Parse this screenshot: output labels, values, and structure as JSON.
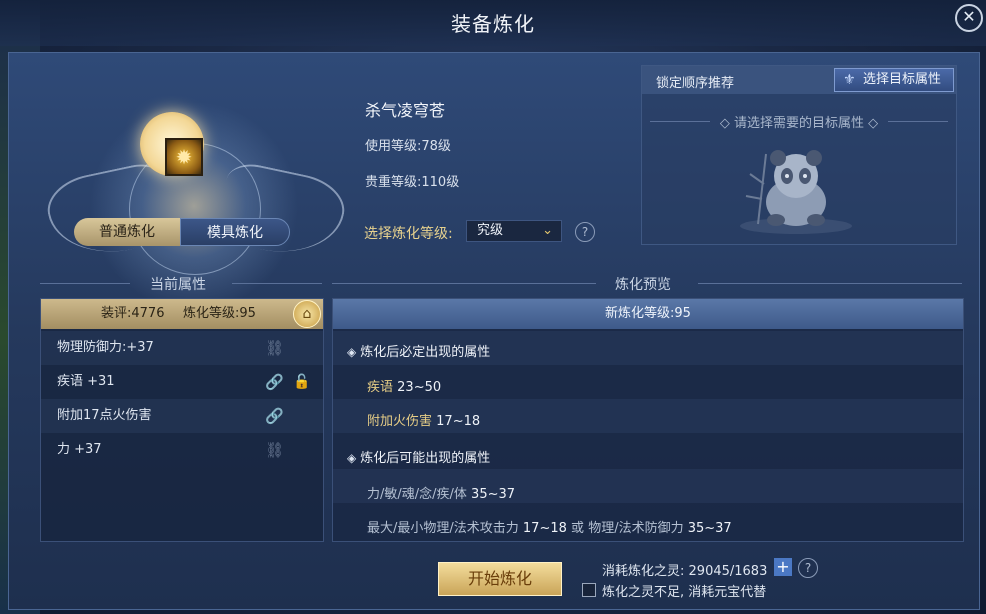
{
  "window": {
    "title": "装备炼化",
    "close_icon": "close-icon"
  },
  "tabs": {
    "normal": "普通炼化",
    "mold": "模具炼化"
  },
  "item": {
    "name": "杀气凌穹苍",
    "use_level_label": "使用等级:",
    "use_level_value": "78级",
    "value_level_label": "贵重等级:",
    "value_level_value": "110级",
    "icon": "emblem-icon"
  },
  "refine": {
    "label": "选择炼化等级:",
    "selected": "究级",
    "help": "?"
  },
  "lock_panel": {
    "label": "锁定顺序推荐",
    "target_button": "选择目标属性",
    "hint": "请选择需要的目标属性"
  },
  "current": {
    "section_title": "当前属性",
    "score": "装评:4776",
    "refine_level": "炼化等级:95",
    "rows": [
      {
        "text": "物理防御力:+37",
        "link": "broken"
      },
      {
        "text": "疾语 +31",
        "link": "linked",
        "lock": "unlocked"
      },
      {
        "text": "附加17点火伤害",
        "link": "linked"
      },
      {
        "text": "力 +37",
        "link": "broken"
      }
    ]
  },
  "preview": {
    "section_title": "炼化预览",
    "new_level": "新炼化等级:95",
    "must_title": "炼化后必定出现的属性",
    "must_rows": [
      {
        "name": "疾语",
        "range": "23~50"
      },
      {
        "name": "附加火伤害",
        "range": "17~18"
      }
    ],
    "may_title": "炼化后可能出现的属性",
    "may_rows": [
      {
        "name": "力/敏/魂/念/疾/体",
        "range": "35~37"
      },
      {
        "name": "最大/最小物理/法术攻击力",
        "range": "17~18",
        "or": "或",
        "name2": "物理/法术防御力",
        "range2": "35~37"
      }
    ]
  },
  "bottom": {
    "start_button": "开始炼化",
    "cost_label": "消耗炼化之灵:",
    "cost_value": "29045/1683",
    "checkbox_label": "炼化之灵不足, 消耗元宝代替",
    "help": "?"
  }
}
